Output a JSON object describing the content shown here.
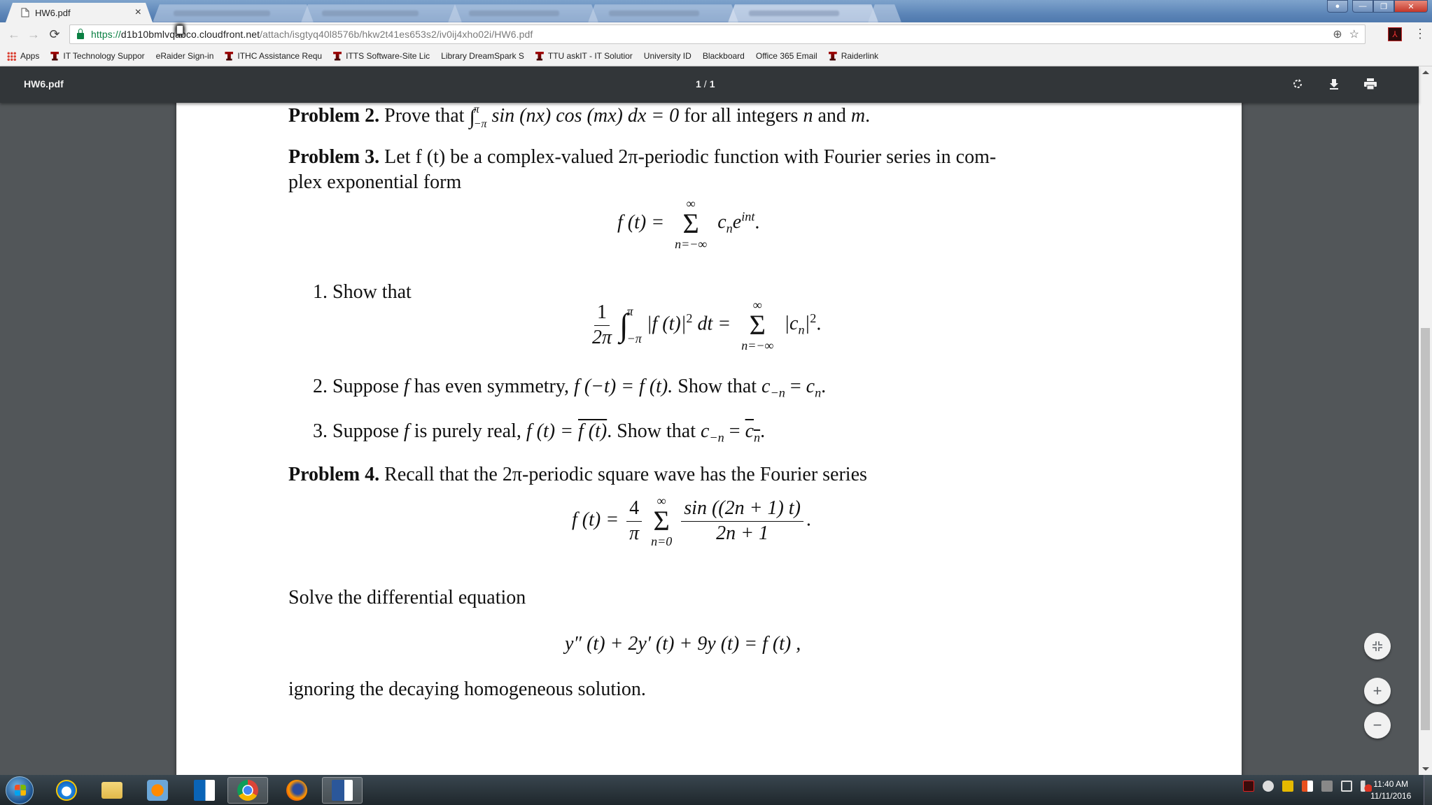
{
  "browser": {
    "active_tab": {
      "title": "HW6.pdf",
      "icon": "document-icon",
      "close": "×"
    },
    "other_tabs_count": 5,
    "url": {
      "scheme": "https://",
      "host": "d1b10bmlvqabco.cloudfront.net",
      "path": "/attach/isgtyq40l8576b/hkw2t41es653s2/iv0ij4xho02i/HW6.pdf"
    },
    "nav": {
      "back": "←",
      "forward": "→",
      "reload": "⟳"
    },
    "omnibox_icons": [
      "zoom-icon",
      "star-icon"
    ],
    "menu": "⋮",
    "bookmarks": [
      {
        "label": "Apps",
        "icon": "apps"
      },
      {
        "label": "IT Technology Suppor",
        "icon": "ttu"
      },
      {
        "label": "eRaider Sign-in",
        "icon": "page"
      },
      {
        "label": "ITHC  Assistance Requ",
        "icon": "ttu"
      },
      {
        "label": "ITTS Software-Site Lic",
        "icon": "ttu"
      },
      {
        "label": "Library DreamSpark S",
        "icon": "page"
      },
      {
        "label": "TTU askIT - IT Solutior",
        "icon": "ttu"
      },
      {
        "label": "University ID",
        "icon": "page"
      },
      {
        "label": "Blackboard",
        "icon": "page"
      },
      {
        "label": "Office 365 Email",
        "icon": "page"
      },
      {
        "label": "Raiderlink",
        "icon": "ttu"
      }
    ]
  },
  "pdf_viewer": {
    "title": "HW6.pdf",
    "current_page": "1",
    "page_separator": "/",
    "total_pages": "1",
    "actions": {
      "rotate": "⟳",
      "download": "⤓",
      "print": "⎙"
    },
    "zoom_controls": {
      "fit": "⤡",
      "zoom_in": "+",
      "zoom_out": "−"
    }
  },
  "document": {
    "problem2": {
      "label": "Problem 2.",
      "text_before": "Prove that",
      "integral_upper": "π",
      "integral_lower": "−π",
      "integrand": "sin (nx) cos (mx) dx = 0",
      "text_after": "for all integers",
      "var1": "n",
      "and": "and",
      "var2": "m",
      "end": "."
    },
    "problem3": {
      "label": "Problem 3.",
      "line1": "Let f (t) be a complex-valued 2π-periodic function with Fourier series in com-",
      "line2": "plex exponential form",
      "eq1_lhs": "f (t) =",
      "eq1_sum_upper": "∞",
      "eq1_sum_lower": "n=−∞",
      "eq1_term": "c",
      "eq1_term_sub": "n",
      "eq1_term_exp_base": "e",
      "eq1_term_exp": "int",
      "eq1_end": ".",
      "items": [
        {
          "num": "1.",
          "text": "Show that",
          "eq_frac_num": "1",
          "eq_frac_den": "2π",
          "eq_int_upper": "π",
          "eq_int_lower": "−π",
          "eq_integrand": "|f (t)|",
          "eq_integrand_exp": "2",
          "eq_dt": "dt =",
          "eq_sum_upper": "∞",
          "eq_sum_lower": "n=−∞",
          "eq_rhs": "|c",
          "eq_rhs_sub": "n",
          "eq_rhs_close": "|",
          "eq_rhs_exp": "2",
          "eq_end": "."
        },
        {
          "num": "2.",
          "text_a": "Suppose",
          "var": "f",
          "text_b": "has even symmetry,",
          "math": "f (−t) = f (t).",
          "text_c": "Show that",
          "res_lhs": "c",
          "res_lhs_sub": "−n",
          "res_eq": "=",
          "res_rhs": "c",
          "res_rhs_sub": "n",
          "res_end": "."
        },
        {
          "num": "3.",
          "text_a": "Suppose",
          "var": "f",
          "text_b": "is purely real,",
          "math_lhs": "f (t) =",
          "math_conj": "f (t)",
          "math_end": ".",
          "text_c": "Show that",
          "res_lhs": "c",
          "res_lhs_sub": "−n",
          "res_eq": "=",
          "res_rhs_conj": "c",
          "res_rhs_sub": "n",
          "res_end": "."
        }
      ]
    },
    "problem4": {
      "label": "Problem 4.",
      "text": "Recall that the 2π-periodic square wave has the Fourier series",
      "eq_lhs": "f (t) =",
      "eq_frac_num": "4",
      "eq_frac_den": "π",
      "eq_sum_upper": "∞",
      "eq_sum_lower": "n=0",
      "eq_term_num": "sin ((2n + 1) t)",
      "eq_term_den": "2n + 1",
      "eq_end": ".",
      "solve_text": "Solve the differential equation",
      "ode": "y″ (t) + 2y′ (t) + 9y (t) = f (t) ,",
      "closing": "ignoring the decaying homogeneous solution."
    }
  },
  "taskbar": {
    "apps": [
      "start",
      "internet-explorer",
      "file-explorer",
      "media-player",
      "outlook",
      "chrome",
      "firefox",
      "word"
    ],
    "active_app": "chrome",
    "time": "11:40 AM",
    "date": "11/11/2016"
  }
}
